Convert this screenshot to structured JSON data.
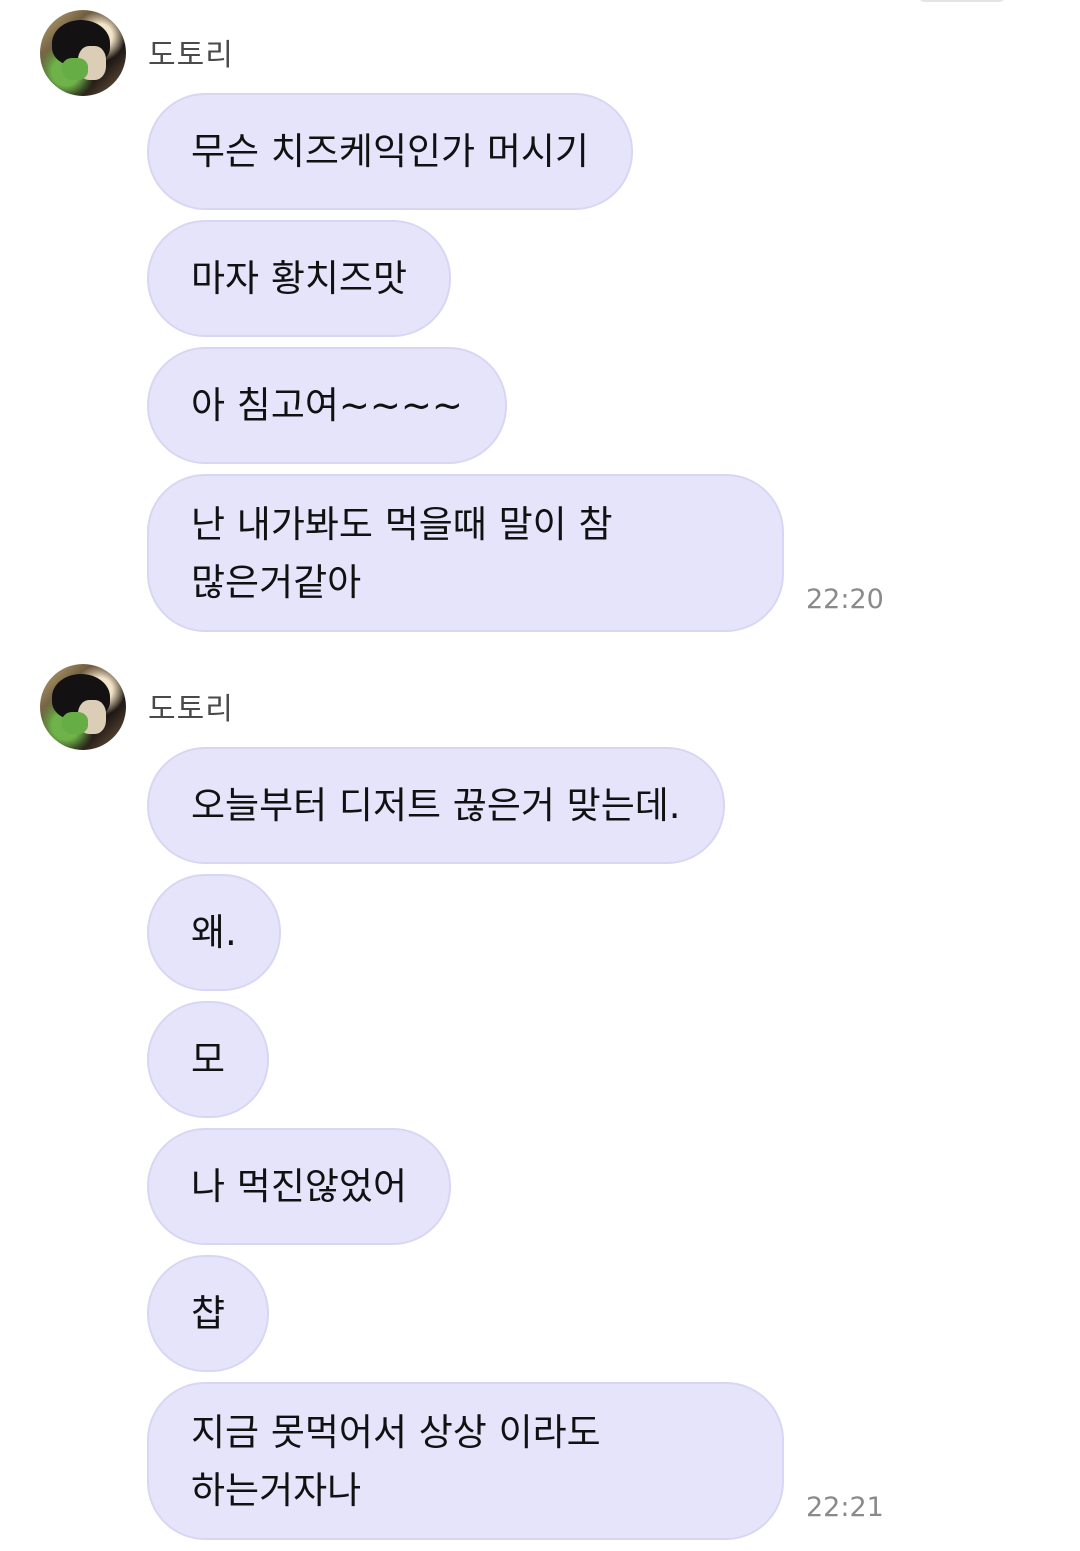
{
  "groups": [
    {
      "sender": "도토리",
      "messages": [
        "무슨 치즈케익인가 머시기",
        "마자 황치즈맛",
        "아 침고여~~~~",
        "난 내가봐도 먹을때 말이 참\n많은거같아"
      ],
      "time": "22:20"
    },
    {
      "sender": "도토리",
      "messages": [
        "오늘부터 디저트 끊은거 맞는데.",
        "왜.",
        "모",
        "나 먹진않었어",
        "챱",
        "지금 못먹어서 상상 이라도\n하는거자나"
      ],
      "time": "22:21"
    }
  ]
}
